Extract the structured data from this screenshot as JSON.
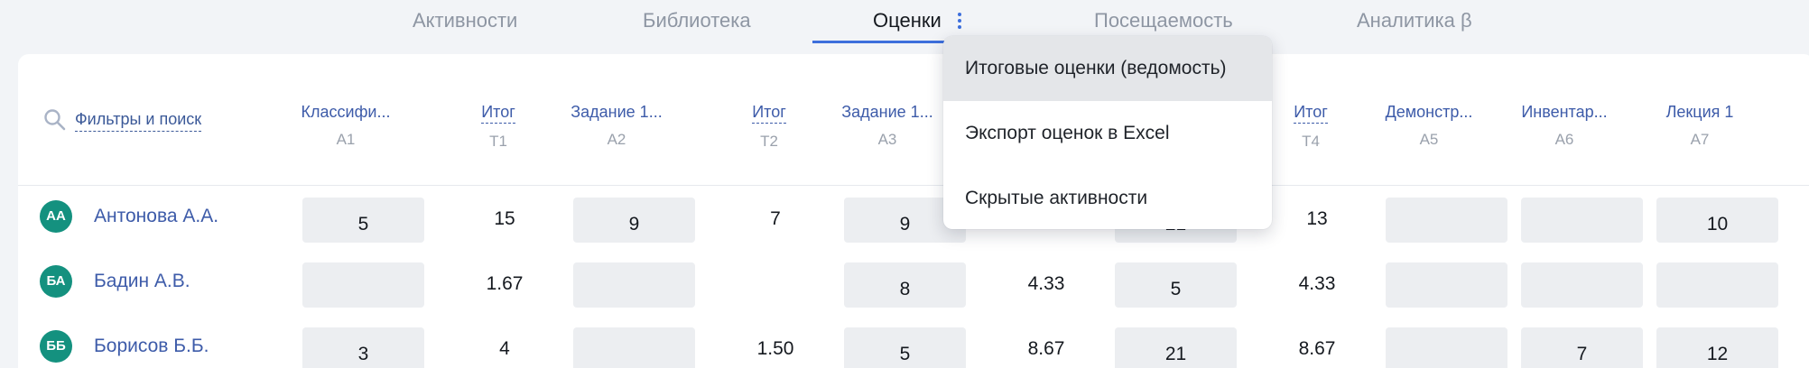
{
  "tabs": [
    {
      "label": "Активности"
    },
    {
      "label": "Библиотека"
    },
    {
      "label": "Оценки",
      "active": true
    },
    {
      "label": "Посещаемость"
    },
    {
      "label": "Аналитика β"
    }
  ],
  "search": {
    "label": "Фильтры и поиск"
  },
  "columns": [
    {
      "title": "Классифи...",
      "code": "А1"
    },
    {
      "title": "Итог",
      "code": "Т1"
    },
    {
      "title": "Задание 1...",
      "code": "А2"
    },
    {
      "title": "Итог",
      "code": "Т2"
    },
    {
      "title": "Задание 1...",
      "code": "А3"
    },
    {
      "title": "Итог",
      "code": "Т4"
    },
    {
      "title": "Демонстр...",
      "code": "А5"
    },
    {
      "title": "Инвентар...",
      "code": "А6"
    },
    {
      "title": "Лекция 1",
      "code": "А7"
    }
  ],
  "rows": [
    {
      "initials": "АА",
      "name": "Антонова А.А.",
      "cells": [
        "5",
        "15",
        "9",
        "7",
        "9",
        "",
        "21",
        "13",
        "",
        "",
        "10"
      ]
    },
    {
      "initials": "БА",
      "name": "Бадин А.В.",
      "cells": [
        "",
        "1.67",
        "",
        "",
        "8",
        "4.33",
        "5",
        "4.33",
        "",
        "",
        ""
      ]
    },
    {
      "initials": "ББ",
      "name": "Борисов Б.Б.",
      "cells": [
        "3",
        "4",
        "",
        "1.50",
        "5",
        "8.67",
        "21",
        "8.67",
        "",
        "7",
        "12"
      ]
    }
  ],
  "menu": {
    "items": [
      {
        "label": "Итоговые оценки (ведомость)"
      },
      {
        "label": "Экспорт оценок в Excel"
      },
      {
        "label": "Скрытые активности"
      }
    ]
  },
  "colors": {
    "accent": "#3d6fdc",
    "avatar": "#14917f",
    "link": "#3d5ba9"
  }
}
